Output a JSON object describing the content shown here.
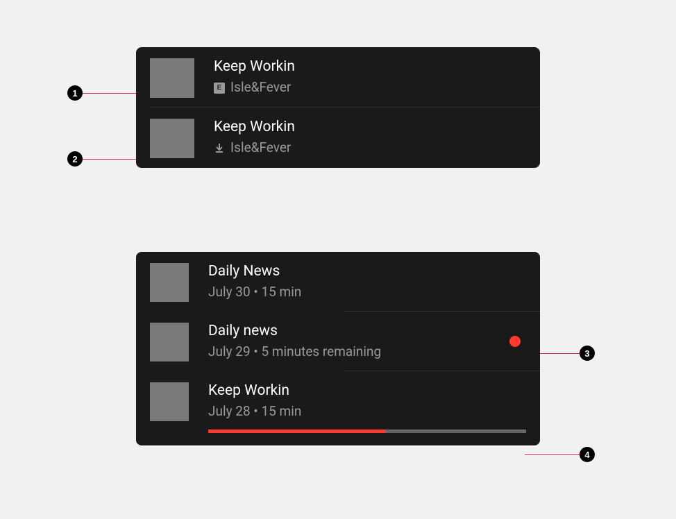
{
  "tracks": [
    {
      "title": "Keep Workin",
      "artist": "Isle&Fever",
      "badge_letter": "E",
      "badge_type": "explicit"
    },
    {
      "title": "Keep Workin",
      "artist": "Isle&Fever",
      "badge_type": "download"
    }
  ],
  "episodes": [
    {
      "title": "Daily News",
      "subtitle": "July 30 • 15 min",
      "has_dot": false,
      "has_progress": false
    },
    {
      "title": "Daily news",
      "subtitle": "July 29 • 5 minutes remaining",
      "has_dot": true,
      "has_progress": false
    },
    {
      "title": "Keep Workin",
      "subtitle": "July 28 • 15 min",
      "has_dot": false,
      "has_progress": true,
      "progress_percent": 56
    }
  ],
  "callouts": {
    "c1": "1",
    "c2": "2",
    "c3": "3",
    "c4": "4"
  },
  "colors": {
    "accent": "#ff3b30",
    "callout_line": "#d4256f"
  }
}
